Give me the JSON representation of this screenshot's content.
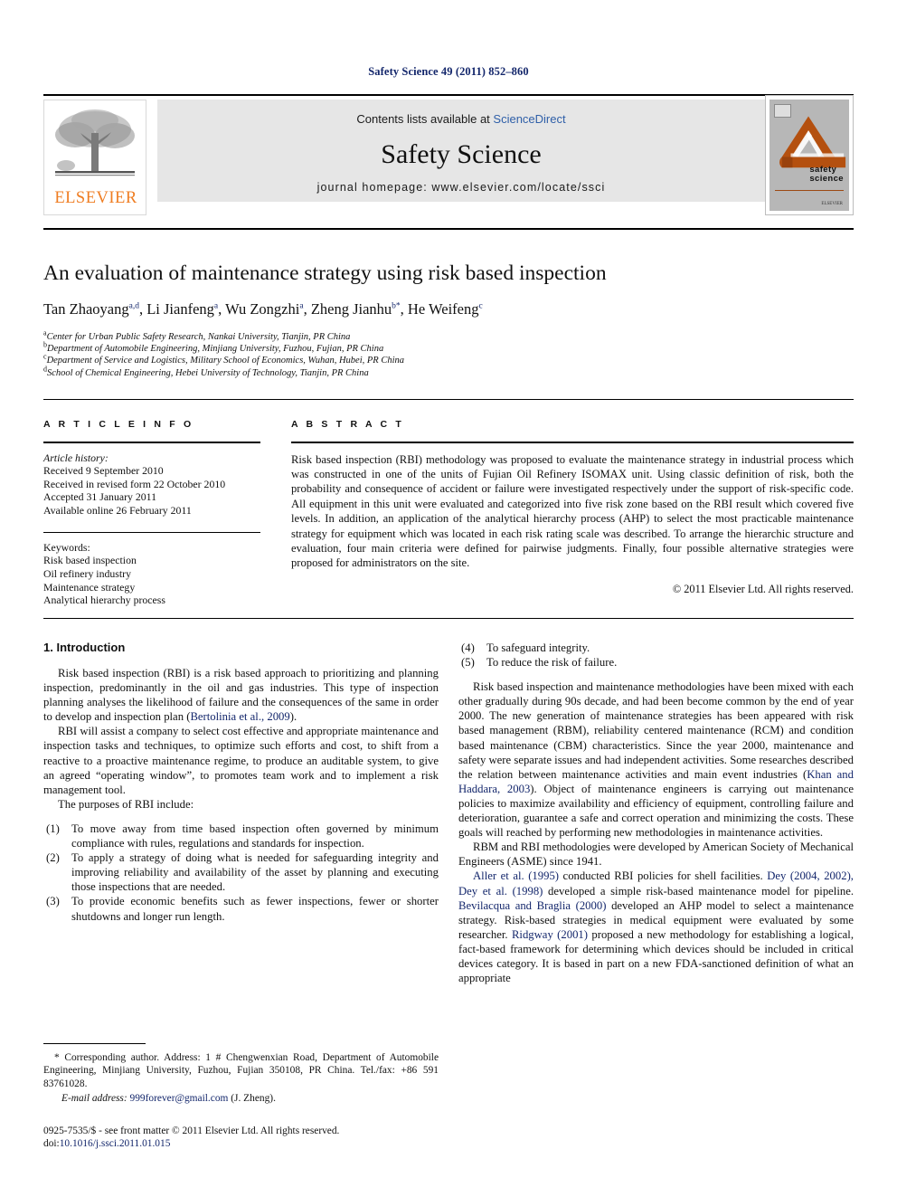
{
  "running_head": "Safety Science 49 (2011) 852–860",
  "masthead": {
    "publisher_logo_name": "elsevier-tree-logo",
    "publisher_wordmark": "ELSEVIER",
    "contents_prefix": "Contents lists available at ",
    "contents_link": "ScienceDirect",
    "journal_name": "Safety Science",
    "homepage": "journal homepage: www.elsevier.com/locate/ssci",
    "cover": {
      "title_line1": "safety",
      "title_line2": "science",
      "publisher_mark": "ELSEVIER",
      "accent_color": "#b4500f",
      "background_color": "#b7b7b7"
    }
  },
  "article": {
    "title": "An evaluation of maintenance strategy using risk based inspection",
    "authors": [
      {
        "name": "Tan Zhaoyang",
        "sup": "a,d",
        "sep": ", "
      },
      {
        "name": "Li Jianfeng",
        "sup": "a",
        "sep": ", "
      },
      {
        "name": "Wu Zongzhi",
        "sup": "a",
        "sep": ", "
      },
      {
        "name": "Zheng Jianhu",
        "sup": "b*",
        "sep": ", "
      },
      {
        "name": "He Weifeng",
        "sup": "c",
        "sep": ""
      }
    ],
    "affiliations": [
      {
        "mark": "a",
        "text": "Center for Urban Public Safety Research, Nankai University, Tianjin, PR China"
      },
      {
        "mark": "b",
        "text": "Department of Automobile Engineering, Minjiang University, Fuzhou, Fujian, PR China"
      },
      {
        "mark": "c",
        "text": "Department of Service and Logistics, Military School of Economics, Wuhan, Hubei, PR China"
      },
      {
        "mark": "d",
        "text": "School of Chemical Engineering, Hebei University of Technology, Tianjin, PR China"
      }
    ]
  },
  "article_info": {
    "heading": "A R T I C L E  I N F O",
    "history_label": "Article history:",
    "history": [
      "Received 9 September 2010",
      "Received in revised form 22 October 2010",
      "Accepted 31 January 2011",
      "Available online 26 February 2011"
    ],
    "keywords_label": "Keywords:",
    "keywords": [
      "Risk based inspection",
      "Oil refinery industry",
      "Maintenance strategy",
      "Analytical hierarchy process"
    ]
  },
  "abstract": {
    "heading": "A B S T R A C T",
    "text": "Risk based inspection (RBI) methodology was proposed to evaluate the maintenance strategy in industrial process which was constructed in one of the units of Fujian Oil Refinery ISOMAX unit. Using classic definition of risk, both the probability and consequence of accident or failure were investigated respectively under the support of risk-specific code. All equipment in this unit were evaluated and categorized into five risk zone based on the RBI result which covered five levels. In addition, an application of the analytical hierarchy process (AHP) to select the most practicable maintenance strategy for equipment which was located in each risk rating scale was described. To arrange the hierarchic structure and evaluation, four main criteria were defined for pairwise judgments. Finally, four possible alternative strategies were proposed for administrators on the site.",
    "copyright": "© 2011 Elsevier Ltd. All rights reserved."
  },
  "body": {
    "section_heading": "1. Introduction",
    "left": {
      "para1_a": "Risk based inspection (RBI) is a risk based approach to prioritizing and planning inspection, predominantly in the oil and gas industries. This type of inspection planning analyses the likelihood of failure and the consequences of the same in order to develop and inspection plan (",
      "para1_ref": "Bertolinia et al., 2009",
      "para1_b": ").",
      "para2": "RBI will assist a company to select cost effective and appropriate maintenance and inspection tasks and techniques, to optimize such efforts and cost, to shift from a reactive to a proactive maintenance regime, to produce an auditable system, to give an agreed “operating window”, to promotes team work and to implement a risk management tool.",
      "para3": "The purposes of RBI include:",
      "list": [
        {
          "mark": "(1)",
          "text": "To move away from time based inspection often governed by minimum compliance with rules, regulations and standards for inspection."
        },
        {
          "mark": "(2)",
          "text": "To apply a strategy of doing what is needed for safeguarding integrity and improving reliability and availability of the asset by planning and executing those inspections that are needed."
        },
        {
          "mark": "(3)",
          "text": "To provide economic benefits such as fewer inspections, fewer or shorter shutdowns and longer run length."
        }
      ]
    },
    "right": {
      "list": [
        {
          "mark": "(4)",
          "text": "To safeguard integrity."
        },
        {
          "mark": "(5)",
          "text": "To reduce the risk of failure."
        }
      ],
      "para1_a": "Risk based inspection and maintenance methodologies have been mixed with each other gradually during 90s decade, and had been become common by the end of year 2000. The new generation of maintenance strategies has been appeared with risk based management (RBM), reliability centered maintenance (RCM) and condition based maintenance (CBM) characteristics. Since the year 2000, maintenance and safety were separate issues and had independent activities. Some researches described the relation between maintenance activities and main event industries (",
      "para1_ref": "Khan and Haddara, 2003",
      "para1_b": "). Object of maintenance engineers is carrying out maintenance policies to maximize availability and efficiency of equipment, controlling failure and deterioration, guarantee a safe and correct operation and minimizing the costs. These goals will reached by performing new methodologies in maintenance activities.",
      "para2": "RBM and RBI methodologies were developed by American Society of Mechanical Engineers (ASME) since 1941.",
      "para3_ref1": "Aller et al. (1995)",
      "para3_a": " conducted RBI policies for shell facilities. ",
      "para3_ref2": "Dey (2004, 2002), Dey et al. (1998)",
      "para3_b": " developed a simple risk-based maintenance model for pipeline. ",
      "para3_ref3": "Bevilacqua and Braglia (2000)",
      "para3_c": " developed an AHP model to select a maintenance strategy. Risk-based strategies in medical equipment were evaluated by some researcher. ",
      "para3_ref4": "Ridgway (2001)",
      "para3_d": " proposed a new methodology for establishing a logical, fact-based framework for determining which devices should be included in critical devices category. It is based in part on a new FDA-sanctioned definition of what an appropriate"
    }
  },
  "footnotes": {
    "corresponding": "* Corresponding author. Address: 1 # Chengwenxian Road, Department of Automobile Engineering, Minjiang University, Fuzhou, Fujian 350108, PR China. Tel./fax: +86 591 83761028.",
    "email_label": "E-mail address:",
    "email": "999forever@gmail.com",
    "email_owner": "(J. Zheng).",
    "issn_line": "0925-7535/$ - see front matter © 2011 Elsevier Ltd. All rights reserved.",
    "doi_label": "doi:",
    "doi": "10.1016/j.ssci.2011.01.015"
  }
}
